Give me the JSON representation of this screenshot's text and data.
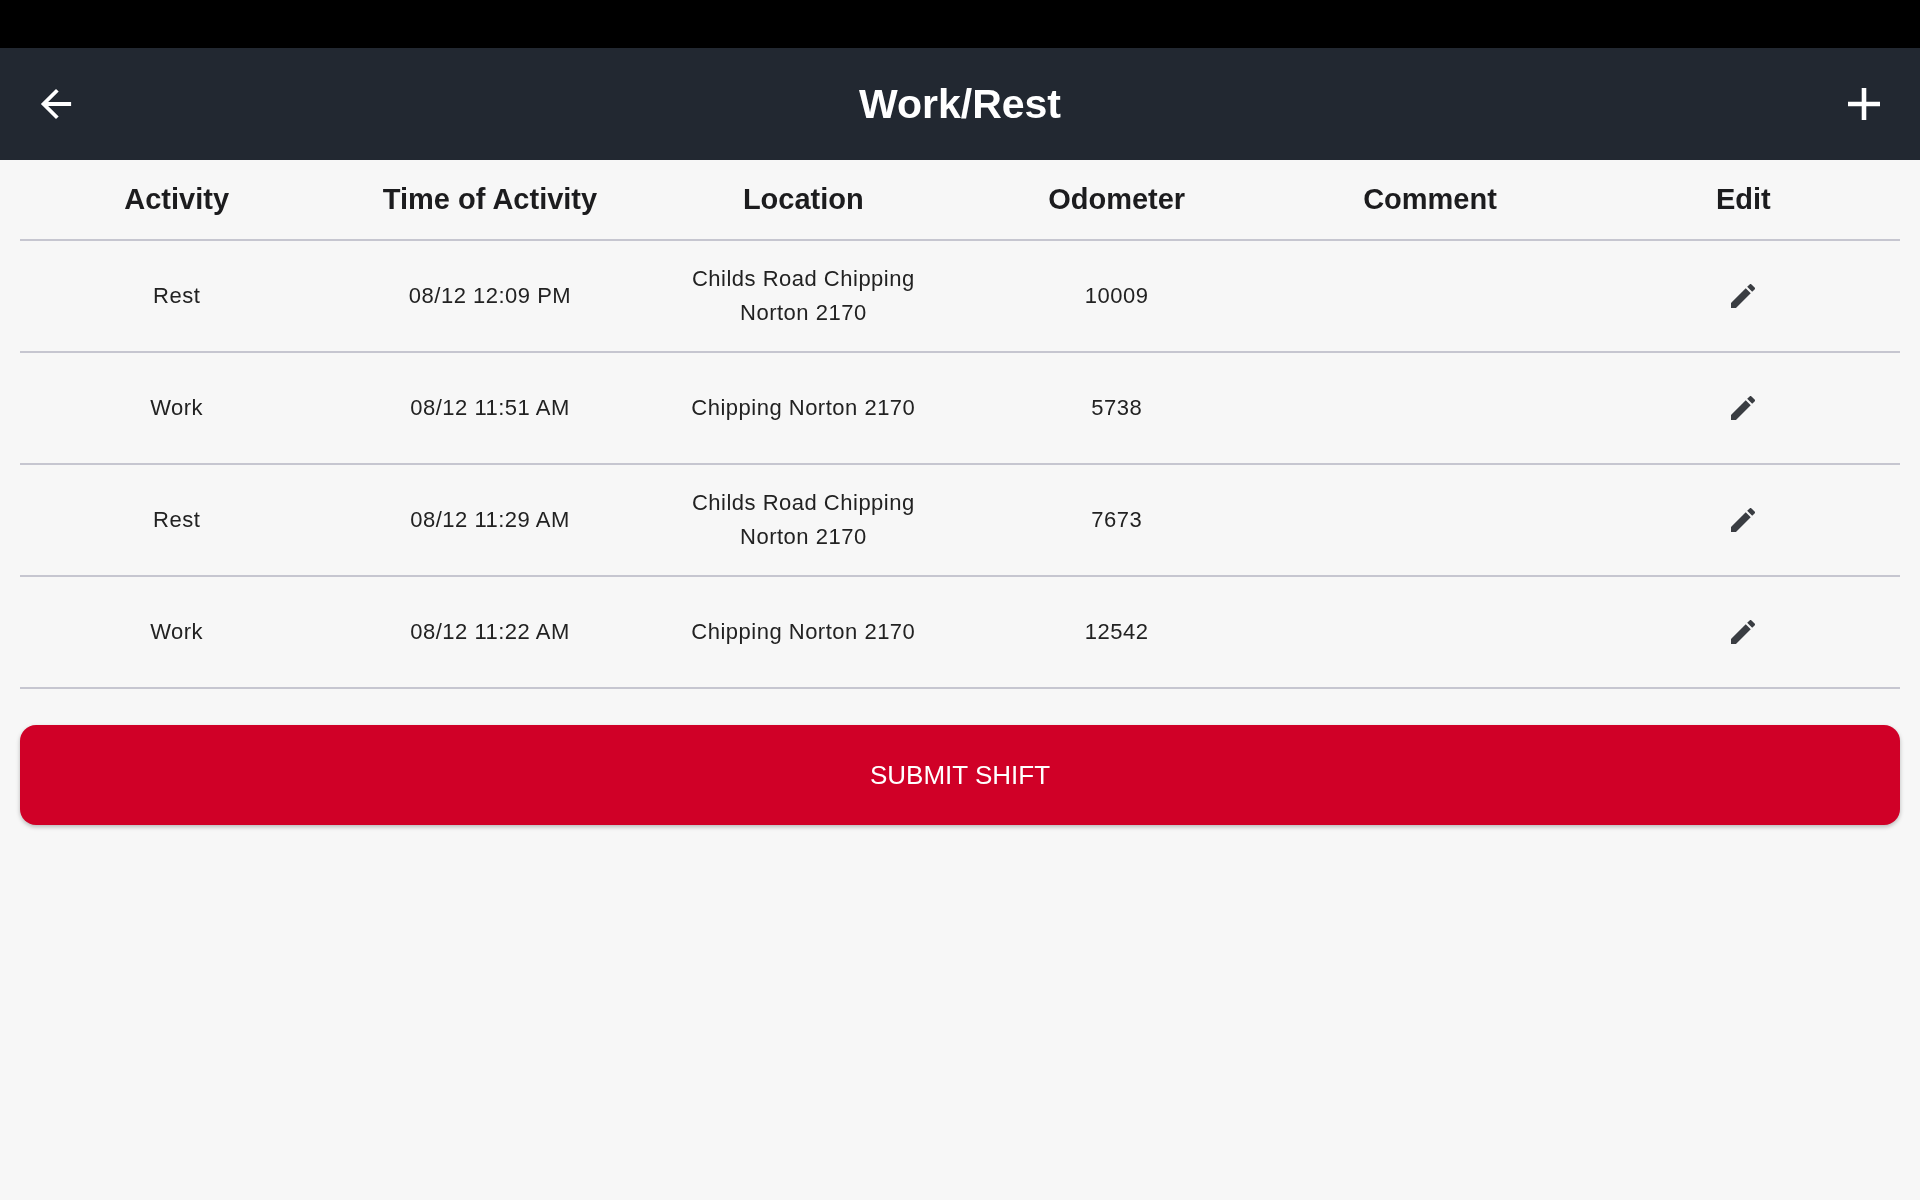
{
  "app_bar": {
    "title": "Work/Rest"
  },
  "table": {
    "columns": [
      "Activity",
      "Time of Activity",
      "Location",
      "Odometer",
      "Comment",
      "Edit"
    ],
    "rows": [
      {
        "activity": "Rest",
        "time_of_activity": "08/12 12:09 PM",
        "location": "Childs Road Chipping Norton 2170",
        "odometer": "10009"
      },
      {
        "activity": "Work",
        "time_of_activity": "08/12 11:51 AM",
        "location": "Chipping Norton 2170",
        "odometer": "5738"
      },
      {
        "activity": "Rest",
        "time_of_activity": "08/12 11:29 AM",
        "location": "Childs Road Chipping Norton 2170",
        "odometer": "7673"
      },
      {
        "activity": "Work",
        "time_of_activity": "08/12 11:22 AM",
        "location": "Chipping Norton 2170",
        "odometer": "12542"
      }
    ]
  },
  "submit_button": {
    "label": "SUBMIT SHIFT"
  }
}
